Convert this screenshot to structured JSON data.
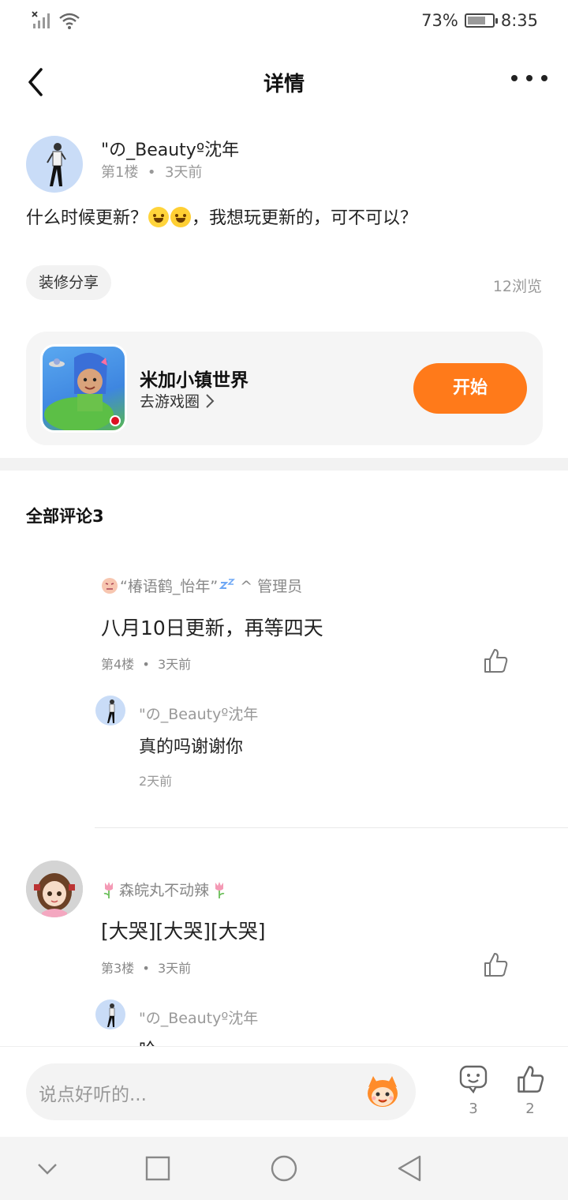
{
  "status_bar": {
    "battery": "73%",
    "battery_level": 0.73,
    "time": "8:35"
  },
  "nav": {
    "title": "详情"
  },
  "post": {
    "author": "\"の_Beautyº沈年",
    "floor": "第1楼",
    "time": "3天前",
    "text_before": "什么时候更新？",
    "text_after": "，我想玩更新的，可不可以？",
    "emoji_count": 2,
    "tag": "装修分享",
    "views": "12浏览"
  },
  "game_card": {
    "name": "米加小镇世界",
    "link": "去游戏圈",
    "button": "开始",
    "accent": "#ff7a1a"
  },
  "comments_header": "全部评论3",
  "comments": [
    {
      "user": "“椿语鹤_怡年”",
      "badge": "^ 管理员",
      "text": "八月10日更新，再等四天",
      "floor": "第4楼",
      "time": "3天前",
      "reply": {
        "user": "\"の_Beautyº沈年",
        "text": "真的吗谢谢你",
        "time": "2天前"
      }
    },
    {
      "user": "森皖丸不动辣",
      "text": "[大哭][大哭][大哭]",
      "floor": "第3楼",
      "time": "3天前",
      "reply": {
        "user": "\"の_Beautyº沈年",
        "text": "哈"
      }
    }
  ],
  "bottom_bar": {
    "placeholder": "说点好听的...",
    "comment_count": "3",
    "like_count": "2"
  }
}
